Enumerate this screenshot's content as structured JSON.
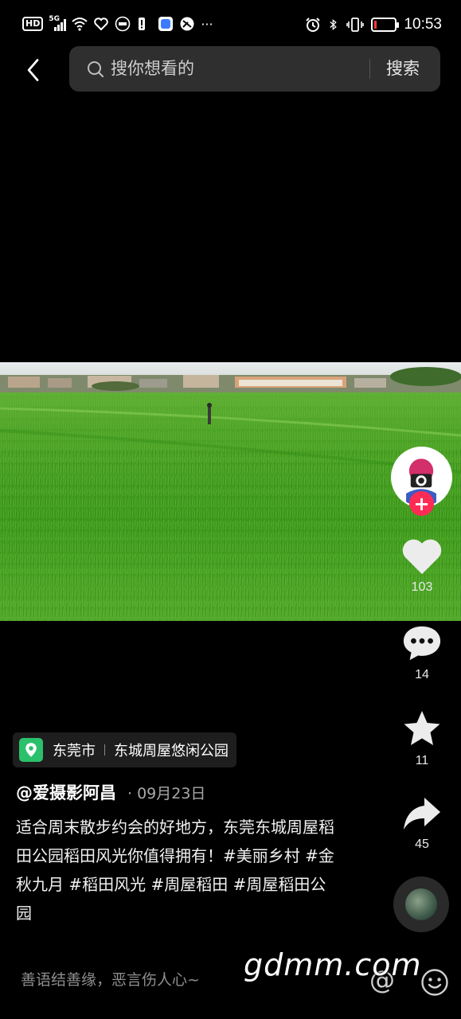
{
  "status_bar": {
    "hd": "HD",
    "network": "5G",
    "time": "10:53",
    "more": "···",
    "icons": [
      "hd-icon",
      "signal-icon",
      "wifi-icon",
      "health-icon",
      "jd-icon",
      "notification-icon",
      "app-icon",
      "vpn-icon",
      "alarm-icon",
      "bluetooth-icon",
      "vibrate-icon",
      "battery-icon"
    ],
    "battery_color": "#ff3b30"
  },
  "top_bar": {
    "back_icon": "back-arrow-icon",
    "search_icon": "search-icon",
    "search_placeholder": "搜你想看的",
    "search_button": "搜索"
  },
  "video": {
    "description": "rice-field-landscape"
  },
  "actions": {
    "likes": "103",
    "comments": "14",
    "favorites": "11",
    "shares": "45",
    "follow_symbol": "+",
    "accent_color": "#fe2c55"
  },
  "post": {
    "location_city": "东莞市",
    "location_place": "东城周屋悠闲公园",
    "author": "@爱摄影阿昌",
    "date": "· 09月23日",
    "caption": "适合周末散步约会的好地方，东莞东城周屋稻田公园稻田风光你值得拥有！#美丽乡村 #金秋九月 #稻田风光 #周屋稻田 #周屋稻田公园"
  },
  "comment_bar": {
    "placeholder": "善语结善缘，恶言伤人心~",
    "at_symbol": "@"
  },
  "watermark": "gdmm.com"
}
